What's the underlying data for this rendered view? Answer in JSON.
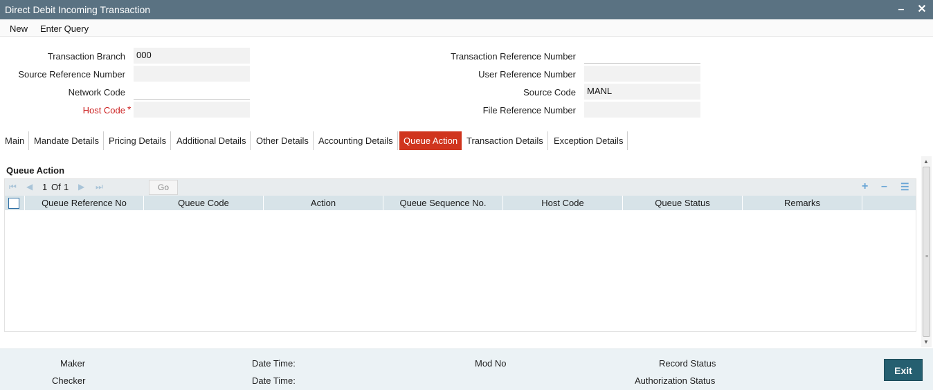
{
  "window": {
    "title": "Direct Debit Incoming Transaction",
    "minimize_icon": "minimize-icon",
    "close_icon": "close-icon"
  },
  "menu": {
    "new": "New",
    "enter_query": "Enter Query"
  },
  "form": {
    "transaction_branch": {
      "label": "Transaction Branch",
      "value": "000"
    },
    "source_reference_number": {
      "label": "Source Reference Number",
      "value": ""
    },
    "network_code": {
      "label": "Network Code",
      "value": ""
    },
    "host_code": {
      "label": "Host Code",
      "required_mark": "*",
      "value": ""
    },
    "transaction_reference_number": {
      "label": "Transaction Reference Number",
      "value": ""
    },
    "user_reference_number": {
      "label": "User Reference Number",
      "value": ""
    },
    "source_code": {
      "label": "Source Code",
      "value": "MANL"
    },
    "file_reference_number": {
      "label": "File Reference Number",
      "value": ""
    }
  },
  "tabs": [
    {
      "label": "Main"
    },
    {
      "label": "Mandate Details"
    },
    {
      "label": "Pricing Details"
    },
    {
      "label": "Additional Details"
    },
    {
      "label": "Other Details"
    },
    {
      "label": "Accounting Details"
    },
    {
      "label": "Queue Action",
      "active": true
    },
    {
      "label": "Transaction Details"
    },
    {
      "label": "Exception Details"
    }
  ],
  "queue_action": {
    "section_title": "Queue Action",
    "pagination": {
      "current_page": "1",
      "of_label": "Of",
      "total_pages": "1",
      "go_label": "Go"
    },
    "columns": [
      "Queue Reference No",
      "Queue Code",
      "Action",
      "Queue Sequence No.",
      "Host Code",
      "Queue Status",
      "Remarks"
    ],
    "rows": []
  },
  "footer": {
    "maker": "Maker",
    "checker": "Checker",
    "maker_date_time": "Date Time:",
    "checker_date_time": "Date Time:",
    "mod_no": "Mod No",
    "record_status": "Record Status",
    "authorization_status": "Authorization Status",
    "exit_label": "Exit"
  },
  "colors": {
    "title_bar": "#5a7282",
    "active_tab": "#d0351e",
    "grid_header": "#d7e3e8",
    "footer_bg": "#ebf2f5",
    "exit_button": "#255f70",
    "required": "#cc2020"
  }
}
